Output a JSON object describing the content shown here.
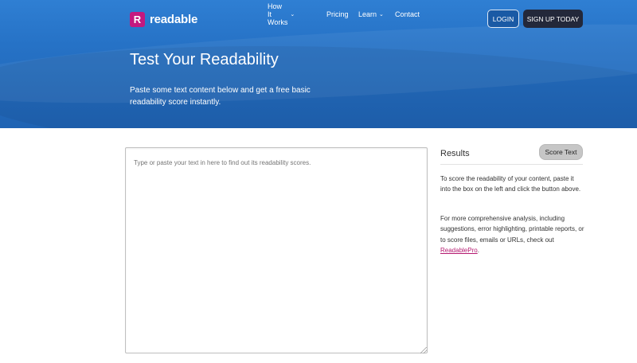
{
  "header": {
    "logo_mark": "R",
    "logo_text": "readable",
    "nav": [
      {
        "label": "How It Works",
        "has_dropdown": true
      },
      {
        "label": "Pricing",
        "has_dropdown": false
      },
      {
        "label": "Learn",
        "has_dropdown": true
      },
      {
        "label": "Contact",
        "has_dropdown": false
      }
    ],
    "login_label": "LOGIN",
    "signup_label": "SIGN UP TODAY"
  },
  "hero": {
    "title": "Test Your Readability",
    "subtitle": "Paste some text content below and get a free basic readability score instantly."
  },
  "editor": {
    "placeholder": "Type or paste your text in here to find out its readability scores.",
    "value": ""
  },
  "results": {
    "title": "Results",
    "score_button_label": "Score Text",
    "paragraph1": "To score the readability of your content, paste it into the box on the left and click the button above.",
    "paragraph2_prefix": "For more comprehensive analysis, including suggestions, error highlighting, printable reports, or to score files, emails or URLs, check out ",
    "paragraph2_link": "ReadablePro",
    "paragraph2_suffix": "."
  },
  "colors": {
    "hero_blue": "#2672c6",
    "brand_magenta": "#c4197f",
    "signup_dark": "#23283a",
    "link": "#b4186f"
  }
}
